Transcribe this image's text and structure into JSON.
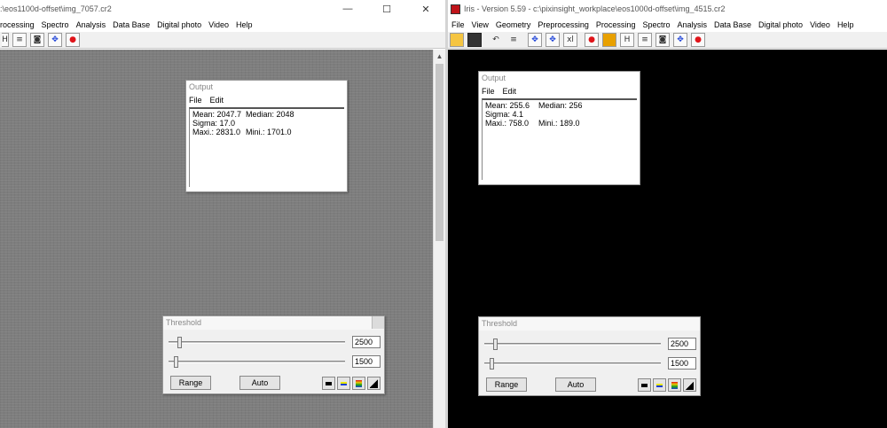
{
  "left_window": {
    "title": ":\\eos1100d-offset\\img_7057.cr2",
    "menu": [
      "rocessing",
      "Spectro",
      "Analysis",
      "Data Base",
      "Digital photo",
      "Video",
      "Help"
    ],
    "caption": {
      "minimize": "—",
      "maximize": "☐",
      "close": "✕"
    },
    "output": {
      "title": "Output",
      "menu": [
        "File",
        "Edit"
      ],
      "mean": "Mean: 2047.7",
      "median": "Median: 2048",
      "sigma": "Sigma: 17.0",
      "maxi": "Maxi.: 2831.0",
      "mini": "Mini.: 1701.0"
    },
    "threshold": {
      "title": "Threshold",
      "high_value": "2500",
      "low_value": "1500",
      "high_level": 0.05,
      "low_level": 0.03,
      "range_label": "Range",
      "auto_label": "Auto"
    }
  },
  "right_window": {
    "title": "Iris - Version 5.59 - c:\\pixinsight_workplace\\eos1000d-offset\\img_4515.cr2",
    "menu": [
      "File",
      "View",
      "Geometry",
      "Preprocessing",
      "Processing",
      "Spectro",
      "Analysis",
      "Data Base",
      "Digital photo",
      "Video",
      "Help"
    ],
    "output": {
      "title": "Output",
      "menu": [
        "File",
        "Edit"
      ],
      "mean": "Mean: 255.6",
      "median": "Median: 256",
      "sigma": "Sigma: 4.1",
      "maxi": "Maxi.: 758.0",
      "mini": "Mini.: 189.0"
    },
    "threshold": {
      "title": "Threshold",
      "high_value": "2500",
      "low_value": "1500",
      "high_level": 0.05,
      "low_level": 0.03,
      "range_label": "Range",
      "auto_label": "Auto"
    }
  },
  "toolbar_glyphs": {
    "xy": "xl",
    "h": "H",
    "lines": "≡",
    "camera": "◙",
    "cross": "✥",
    "dot": "●",
    "undo": "↶"
  },
  "colors": {
    "left_canvas": "#7e7e7e",
    "right_canvas": "#000000",
    "accent_red": "#e0141a",
    "accent_blue": "#1a3fd6"
  }
}
